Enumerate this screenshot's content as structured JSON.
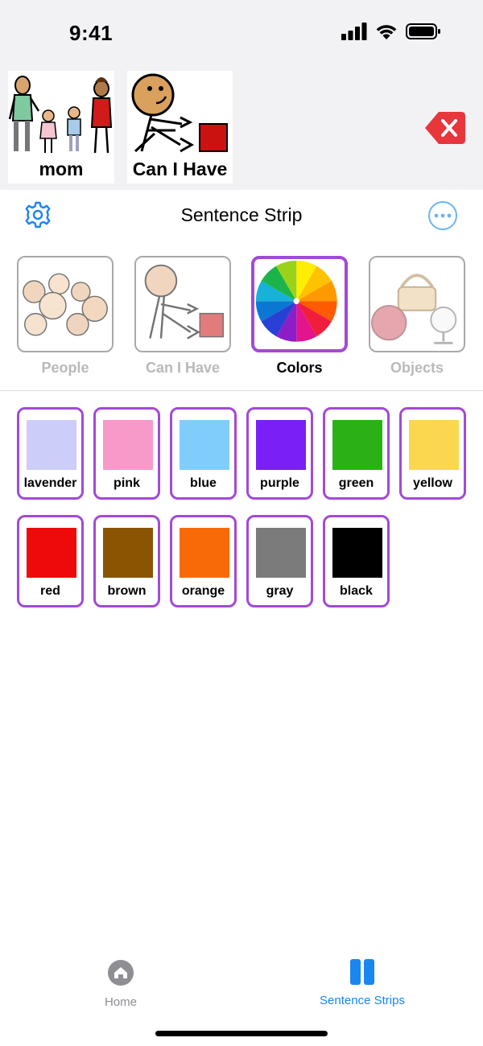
{
  "status_bar": {
    "time": "9:41"
  },
  "sentence_strip": {
    "items": [
      {
        "label": "mom"
      },
      {
        "label": "Can I Have"
      }
    ],
    "backspace_icon": "backspace-x-icon",
    "accent_color": "#e8363d"
  },
  "nav": {
    "title": "Sentence Strip",
    "settings_icon": "gear-icon",
    "more_icon": "ellipsis-circle-icon"
  },
  "categories": [
    {
      "label": "People",
      "selected": false
    },
    {
      "label": "Can I Have",
      "selected": false
    },
    {
      "label": "Colors",
      "selected": true
    },
    {
      "label": "Objects",
      "selected": false
    }
  ],
  "colors": [
    {
      "label": "lavender",
      "hex": "#cdcdf9"
    },
    {
      "label": "pink",
      "hex": "#f79ac9"
    },
    {
      "label": "blue",
      "hex": "#80cdfc"
    },
    {
      "label": "purple",
      "hex": "#7a1ff5"
    },
    {
      "label": "green",
      "hex": "#2bb115"
    },
    {
      "label": "yellow",
      "hex": "#fad74e"
    },
    {
      "label": "red",
      "hex": "#ee0a0a"
    },
    {
      "label": "brown",
      "hex": "#8a5403"
    },
    {
      "label": "orange",
      "hex": "#f86a07"
    },
    {
      "label": "gray",
      "hex": "#7b7b7b"
    },
    {
      "label": "black",
      "hex": "#000000"
    }
  ],
  "tab_bar": {
    "tabs": [
      {
        "label": "Home",
        "icon": "home-icon",
        "active": false
      },
      {
        "label": "Sentence Strips",
        "icon": "columns-icon",
        "active": true
      }
    ]
  },
  "theme": {
    "selection_color": "#a24ad6",
    "active_tab_color": "#1a86f0"
  }
}
